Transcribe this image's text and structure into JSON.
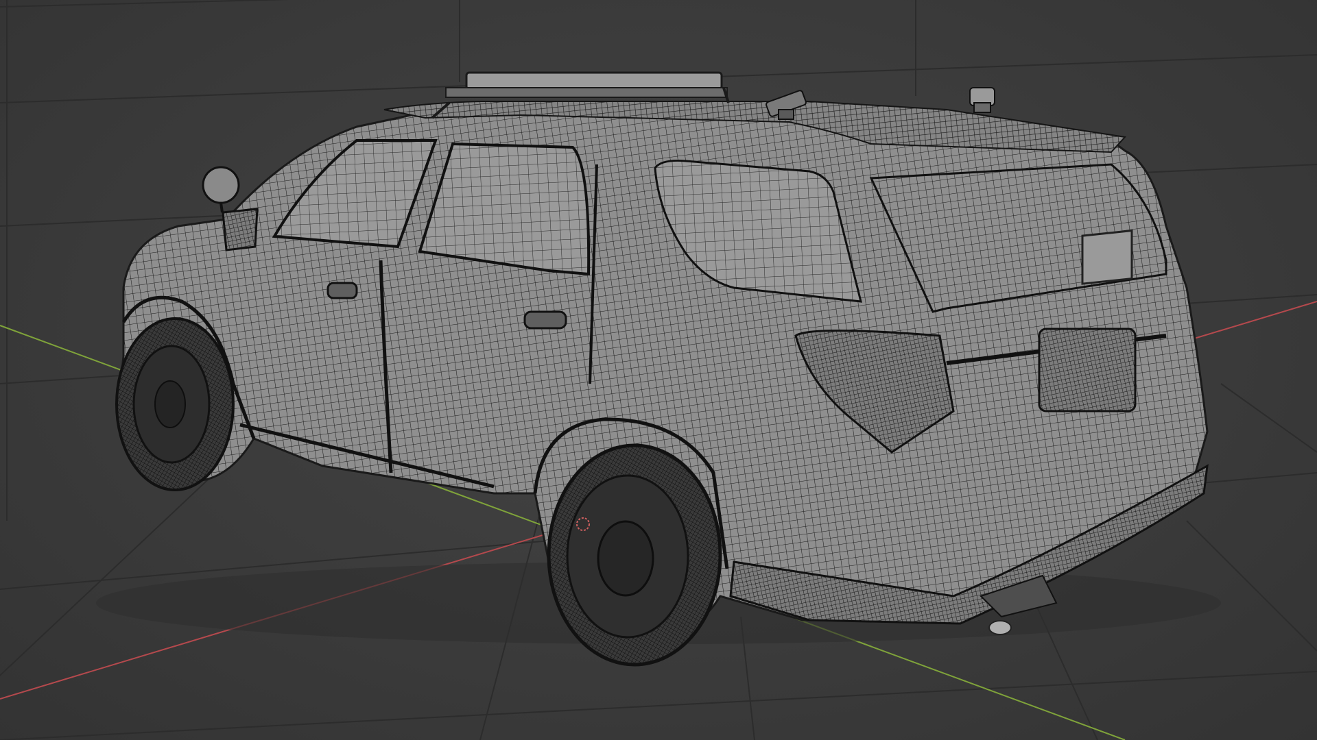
{
  "viewport": {
    "label": "",
    "shading_mode": "wireframe-over-solid",
    "object": "police-suv-model"
  },
  "colors": {
    "background": "#3b3b3b",
    "grid": "#2e2e2e",
    "x_axis": "#b5494d",
    "y_axis": "#7fa33a",
    "mesh_fill": "#8e8e8e",
    "mesh_wire": "#1c1c1c",
    "tire": "#2a2a2a"
  }
}
